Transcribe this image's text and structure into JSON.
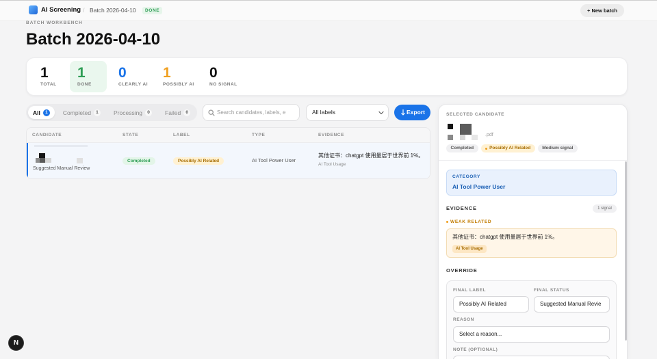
{
  "topbar": {
    "logo_icon": "app-logo-icon",
    "app_name": "AI Screening",
    "separator": "/",
    "breadcrumb": "Batch 2026-04-10",
    "status_badge": "DONE",
    "new_batch_label": "+ New batch"
  },
  "header": {
    "eyebrow": "BATCH WORKBENCH",
    "title": "Batch 2026-04-10"
  },
  "stats": [
    {
      "value": "1",
      "label": "TOTAL",
      "color": "#111111"
    },
    {
      "value": "1",
      "label": "DONE",
      "color": "#2e9d55"
    },
    {
      "value": "0",
      "label": "CLEARLY AI",
      "color": "#1a73e8"
    },
    {
      "value": "1",
      "label": "POSSIBLY AI",
      "color": "#f0a020"
    },
    {
      "value": "0",
      "label": "NO SIGNAL",
      "color": "#111111"
    }
  ],
  "filters": {
    "tabs": [
      {
        "label": "All",
        "count": "1",
        "active": true
      },
      {
        "label": "Completed",
        "count": "1",
        "active": false
      },
      {
        "label": "Processing",
        "count": "0",
        "active": false
      },
      {
        "label": "Failed",
        "count": "0",
        "active": false
      }
    ],
    "search": {
      "placeholder": "Search candidates, labels, e",
      "icon": "search-icon"
    },
    "label_filter": {
      "value": "All labels",
      "icon": "chevron-down-icon"
    },
    "export": {
      "label": "Export",
      "icon": "download-icon"
    }
  },
  "table": {
    "columns": [
      "CANDIDATE",
      "STATE",
      "LABEL",
      "TYPE",
      "EVIDENCE"
    ],
    "rows": [
      {
        "selected": true,
        "recommendation": "Suggested Manual Review",
        "state": "Completed",
        "label": "Possibly AI Related",
        "type": "AI Tool Power User",
        "evidence": "其他证书：chatgpt 使用量居于世界前 1%。",
        "evidence_tag": "AI Tool Usage"
      }
    ]
  },
  "detail": {
    "heading": "SELECTED CANDIDATE",
    "file_extension": ".pdf",
    "badges": [
      "Completed",
      "Possibly AI Related",
      "Medium signal"
    ],
    "category": {
      "heading": "CATEGORY",
      "value": "AI Tool Power User"
    },
    "evidence": {
      "heading": "EVIDENCE",
      "count": "1 signal",
      "strength": "WEAK RELATED",
      "text": "其他证书：chatgpt 使用量居于世界前 1%。",
      "tag": "AI Tool Usage"
    },
    "override": {
      "heading": "OVERRIDE",
      "final_label": {
        "label": "FINAL LABEL",
        "value": "Possibly AI Related"
      },
      "final_status": {
        "label": "FINAL STATUS",
        "value": "Suggested Manual Revie"
      },
      "reason": {
        "label": "REASON",
        "placeholder": "Select a reason..."
      },
      "note": {
        "label": "NOTE (OPTIONAL)"
      }
    }
  },
  "dev_indicator": {
    "label": "N"
  },
  "colors": {
    "accent": "#1a73e8",
    "success": "#2e9d55",
    "warning": "#f0a020"
  }
}
